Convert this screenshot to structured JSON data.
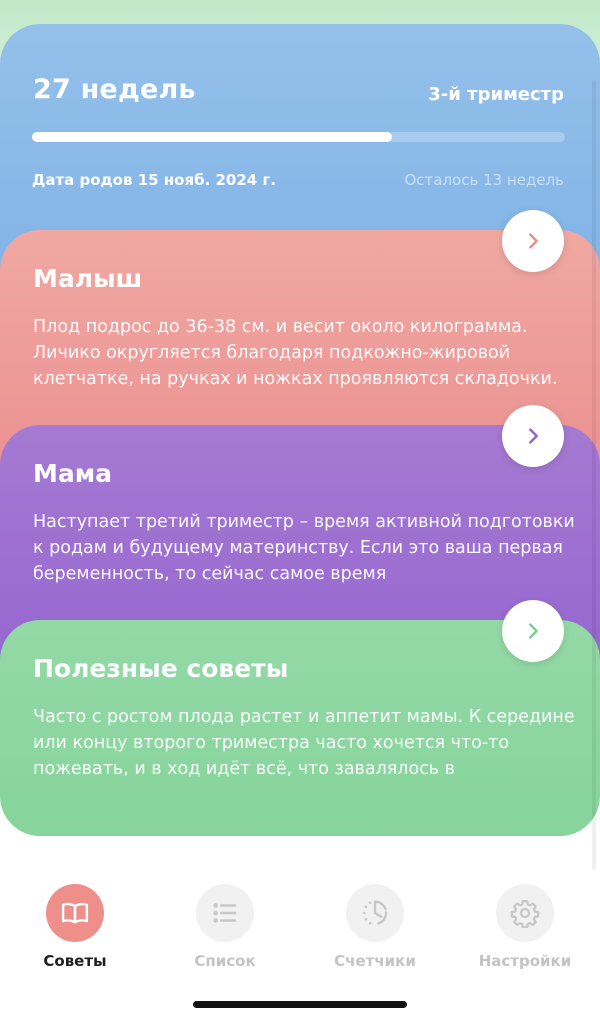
{
  "colors": {
    "week_card": "#8ab9e8",
    "baby_card": "#ee9b98",
    "mom_card": "#9b6dd1",
    "tips_card": "#8dd6a1",
    "tab_active": "#ef8f8c"
  },
  "pregnancy": {
    "week_label": "27 недель",
    "trimester_label": "3-й триместр",
    "progress_fraction": 0.675,
    "due_date_label": "Дата родов 15 нояб. 2024 г.",
    "remaining_label": "Осталось 13 недель"
  },
  "cards": {
    "baby": {
      "title": "Малыш",
      "text": "Плод подрос до 36-38 см. и весит около килограмма. Личико округляется благодаря подкожно-жировой клетчатке, на ручках и ножках проявляются складочки.",
      "arrow_icon": "chevron-right-icon",
      "arrow_color": "#e68b88"
    },
    "mom": {
      "title": "Мама",
      "text": "Наступает третий триместр – время активной подготовки к родам и будущему материнству. Если это ваша первая беременность, то сейчас самое время",
      "arrow_icon": "chevron-right-icon",
      "arrow_color": "#8f62cc"
    },
    "tips": {
      "title": "Полезные советы",
      "text": "Часто с ростом плода растет и аппетит мамы. К середине или концу второго триместра часто хочется что-то пожевать, и в ход идёт всё, что завалялось в",
      "arrow_icon": "chevron-right-icon",
      "arrow_color": "#7ccd93"
    }
  },
  "tabbar": {
    "tabs": [
      {
        "label": "Советы",
        "icon": "book-icon",
        "active": true
      },
      {
        "label": "Список",
        "icon": "list-icon",
        "active": false
      },
      {
        "label": "Счетчики",
        "icon": "timer-icon",
        "active": false
      },
      {
        "label": "Настройки",
        "icon": "gear-icon",
        "active": false
      }
    ]
  }
}
